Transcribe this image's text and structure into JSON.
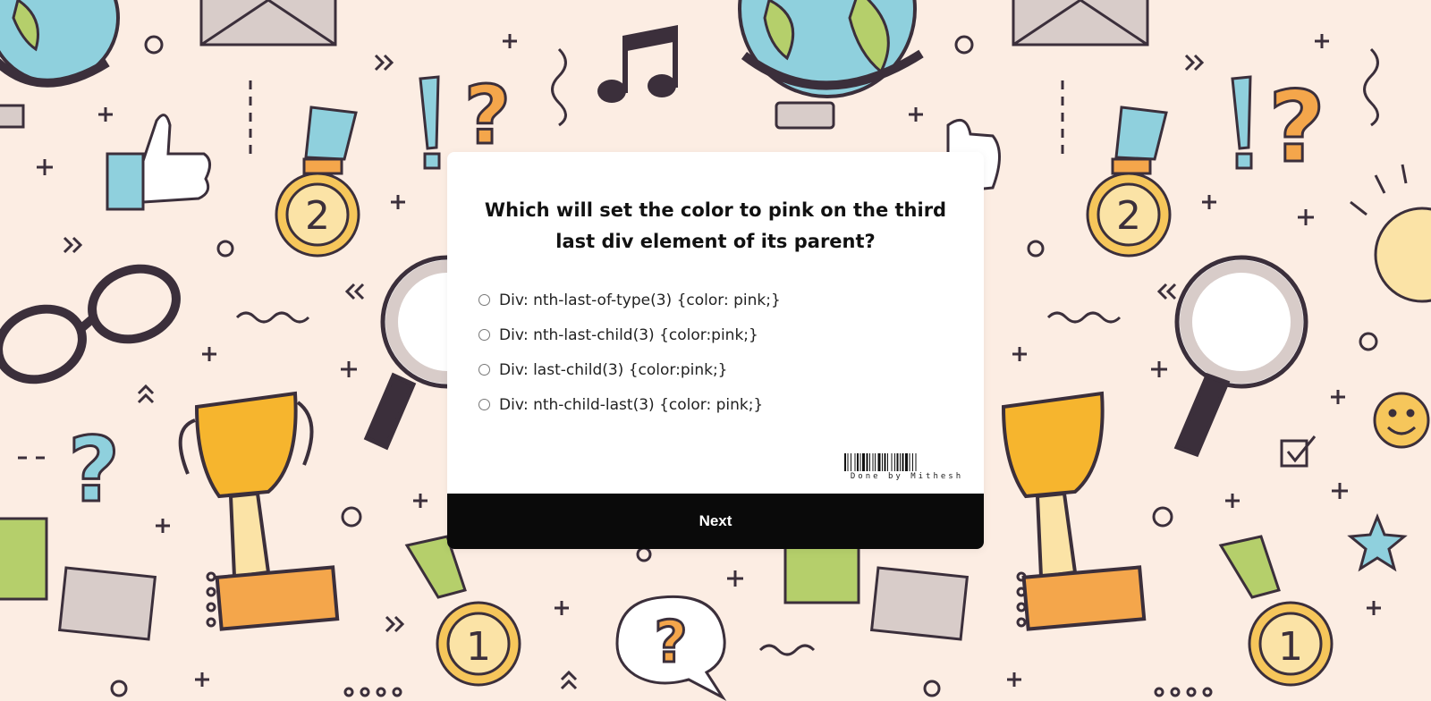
{
  "quiz": {
    "question": "Which will set the color to pink on the third last div element of its parent?",
    "options": [
      {
        "label": "Div: nth-last-of-type(3) {color: pink;}"
      },
      {
        "label": "Div: nth-last-child(3) {color:pink;}"
      },
      {
        "label": "Div: last-child(3) {color:pink;}"
      },
      {
        "label": "Div: nth-child-last(3) {color: pink;}"
      }
    ],
    "barcode_text": "Done by Mithesh",
    "next_label": "Next"
  },
  "colors": {
    "background": "#fcede3",
    "card": "#ffffff",
    "button": "#0a0a0a",
    "button_text": "#ffffff"
  },
  "background_icons": [
    "globe-icon",
    "envelope-icon",
    "music-note-icon",
    "thumbs-up-icon",
    "medal-icon",
    "exclamation-icon",
    "question-mark-icon",
    "glasses-icon",
    "magnifier-icon",
    "trophy-icon",
    "puzzle-piece-icon",
    "lightbulb-icon",
    "smiley-icon",
    "star-icon",
    "checkbox-icon",
    "speech-bubble-icon"
  ]
}
